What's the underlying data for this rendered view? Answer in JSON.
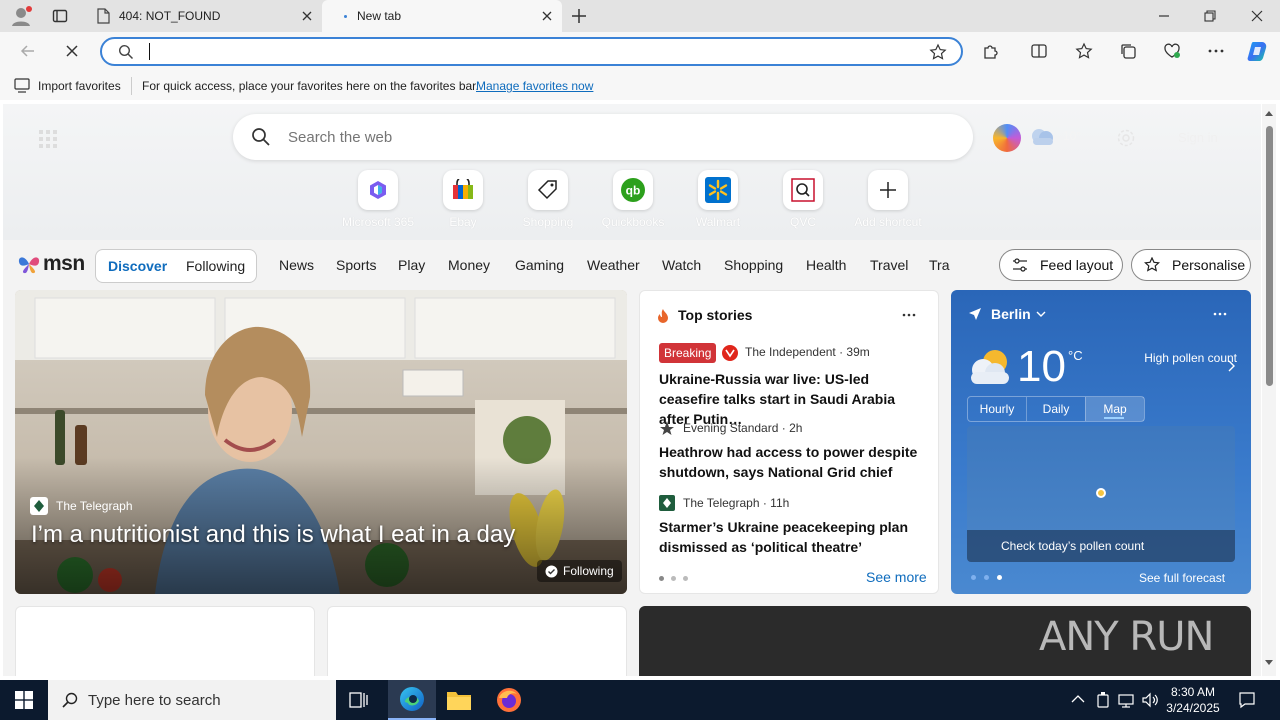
{
  "browser": {
    "tabs": [
      {
        "title": "404: NOT_FOUND"
      },
      {
        "title": "New tab"
      }
    ],
    "omnibox_value": ""
  },
  "favbar": {
    "import_label": "Import favorites",
    "hint": "For quick access, place your favorites here on the favorites bar.",
    "manage_link": "Manage favorites now"
  },
  "search": {
    "placeholder": "Search the web"
  },
  "header_right": {
    "weather_temp": "10°",
    "sign_in": "Sign in"
  },
  "shortcuts": [
    {
      "label": "Microsoft 365",
      "icon": "microsoft365-icon"
    },
    {
      "label": "Ebay",
      "icon": "ebay-icon"
    },
    {
      "label": "Shopping",
      "icon": "shopping-tag-icon"
    },
    {
      "label": "Quickbooks",
      "icon": "quickbooks-icon"
    },
    {
      "label": "Walmart",
      "icon": "walmart-icon"
    },
    {
      "label": "QVC",
      "icon": "qvc-icon"
    },
    {
      "label": "Add shortcut",
      "icon": "plus-icon"
    }
  ],
  "msn": {
    "logo": "msn",
    "pill": [
      "Discover",
      "Following"
    ],
    "nav": [
      "News",
      "Sports",
      "Play",
      "Money",
      "Gaming",
      "Weather",
      "Watch",
      "Shopping",
      "Health",
      "Travel",
      "Tra"
    ],
    "feed_layout": "Feed layout",
    "personalise": "Personalise"
  },
  "hero_article": {
    "source": "The Telegraph",
    "headline": "I’m a nutritionist and this is what I eat in a day",
    "follow": "Following"
  },
  "top_stories": {
    "title": "Top stories",
    "items": [
      {
        "badge": "Breaking",
        "source": "The Independent · 39m",
        "headline": "Ukraine-Russia war live: US-led ceasefire talks start in Saudi Arabia after Putin…"
      },
      {
        "source": "Evening Standard · 2h",
        "headline": "Heathrow had access to power despite shutdown, says National Grid chief"
      },
      {
        "source": "The Telegraph · 11h",
        "headline": "Starmer’s Ukraine peacekeeping plan dismissed as ‘political theatre’"
      }
    ],
    "see_more": "See more"
  },
  "weather": {
    "city": "Berlin",
    "temp": "10",
    "unit": "°C",
    "pollen": "High pollen count",
    "tabs": [
      "Hourly",
      "Daily",
      "Map"
    ],
    "map_caption": "Check today’s pollen count",
    "forecast_link": "See full forecast"
  },
  "watermark": "ANY RUN",
  "taskbar": {
    "search_placeholder": "Type here to search",
    "time": "8:30 AM",
    "date": "3/24/2025"
  },
  "colors": {
    "accent": "#0f6cbd",
    "taskbar": "#0c1a2e",
    "breaking": "#d13438",
    "weather_bg": "#2c6cc0"
  }
}
